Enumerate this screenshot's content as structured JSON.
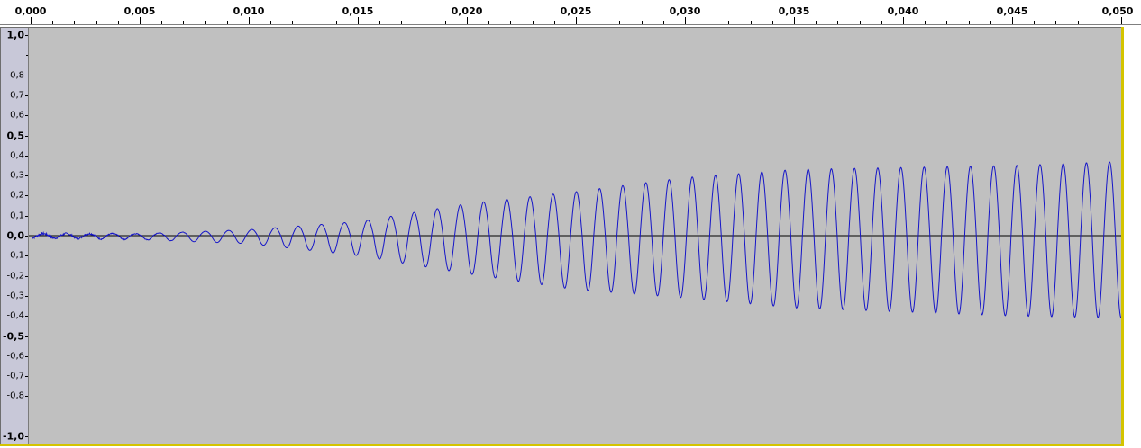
{
  "timeline": {
    "labels": [
      "0,000",
      "0,005",
      "0,010",
      "0,015",
      "0,020",
      "0,025",
      "0,030",
      "0,035",
      "0,040",
      "0,045",
      "0,050"
    ],
    "values": [
      0,
      0.005,
      0.01,
      0.015,
      0.02,
      0.025,
      0.03,
      0.035,
      0.04,
      0.045,
      0.05
    ],
    "range": [
      0,
      0.05
    ]
  },
  "amplitude_ruler": {
    "labels": [
      {
        "text": "1,0",
        "value": 1.0,
        "bold": true
      },
      {
        "text": "0,8",
        "value": 0.8
      },
      {
        "text": "0,7",
        "value": 0.7
      },
      {
        "text": "0,6",
        "value": 0.6
      },
      {
        "text": "0,5",
        "value": 0.5,
        "bold": true
      },
      {
        "text": "0,4",
        "value": 0.4
      },
      {
        "text": "0,3",
        "value": 0.3
      },
      {
        "text": "0,2",
        "value": 0.2
      },
      {
        "text": "0,1",
        "value": 0.1
      },
      {
        "text": "0,0",
        "value": 0.0,
        "bold": true
      },
      {
        "text": "-0,1",
        "value": -0.1
      },
      {
        "text": "-0,2",
        "value": -0.2
      },
      {
        "text": "-0,3",
        "value": -0.3
      },
      {
        "text": "-0,4",
        "value": -0.4
      },
      {
        "text": "-0,5",
        "value": -0.5,
        "bold": true
      },
      {
        "text": "-0,6",
        "value": -0.6
      },
      {
        "text": "-0,7",
        "value": -0.7
      },
      {
        "text": "-0,8",
        "value": -0.8
      },
      {
        "text": "-1,0",
        "value": -1.0,
        "bold": true
      }
    ],
    "range": [
      -1.0,
      1.0
    ]
  },
  "waveform": {
    "color": "#1515c8",
    "baseline_color": "#000000",
    "background_color": "#c0c0c0",
    "cycles": 47,
    "envelope": {
      "time": [
        0,
        0.005,
        0.01,
        0.015,
        0.02,
        0.025,
        0.03,
        0.035,
        0.04,
        0.045,
        0.05
      ],
      "peak_positive": [
        0.01,
        0.01,
        0.03,
        0.07,
        0.16,
        0.22,
        0.29,
        0.33,
        0.34,
        0.35,
        0.37
      ],
      "peak_negative": [
        -0.01,
        -0.02,
        -0.04,
        -0.1,
        -0.19,
        -0.27,
        -0.31,
        -0.36,
        -0.38,
        -0.4,
        -0.41
      ]
    }
  }
}
